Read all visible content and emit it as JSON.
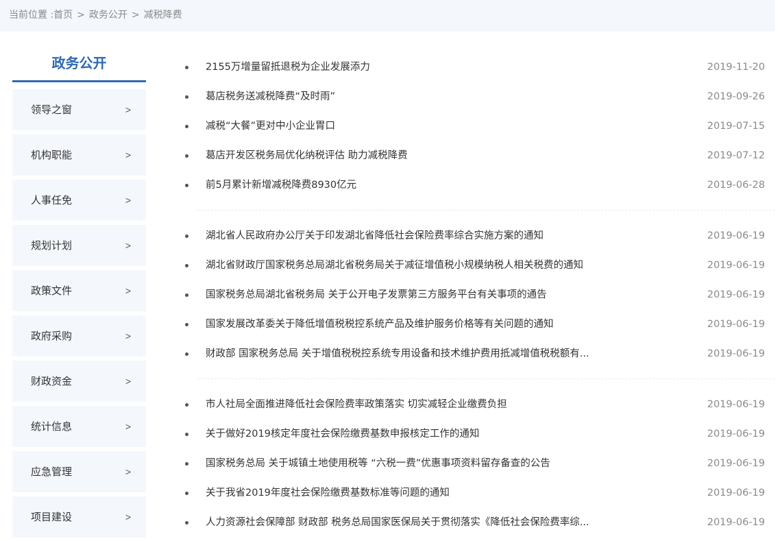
{
  "breadcrumb": {
    "prefix": "当前位置 :",
    "items": [
      "首页",
      "政务公开",
      "减税降费"
    ],
    "separator": ">"
  },
  "sidebar": {
    "title": "政务公开",
    "items": [
      {
        "label": "领导之窗"
      },
      {
        "label": "机构职能"
      },
      {
        "label": "人事任免"
      },
      {
        "label": "规划计划"
      },
      {
        "label": "政策文件"
      },
      {
        "label": "政府采购"
      },
      {
        "label": "财政资金"
      },
      {
        "label": "统计信息"
      },
      {
        "label": "应急管理"
      },
      {
        "label": "项目建设"
      }
    ],
    "chevron": ">"
  },
  "news_groups": [
    [
      {
        "title": "2155万增量留抵退税为企业发展添力",
        "date": "2019-11-20"
      },
      {
        "title": "葛店税务送减税降费“及时雨”",
        "date": "2019-09-26"
      },
      {
        "title": "减税“大餐”更对中小企业胃口",
        "date": "2019-07-15"
      },
      {
        "title": "葛店开发区税务局优化纳税评估 助力减税降费",
        "date": "2019-07-12"
      },
      {
        "title": "前5月累计新增减税降费8930亿元",
        "date": "2019-06-28"
      }
    ],
    [
      {
        "title": "湖北省人民政府办公厅关于印发湖北省降低社会保险费率综合实施方案的通知",
        "date": "2019-06-19"
      },
      {
        "title": "湖北省财政厅国家税务总局湖北省税务局关于减征增值税小规模纳税人相关税费的通知",
        "date": "2019-06-19"
      },
      {
        "title": "国家税务总局湖北省税务局 关于公开电子发票第三方服务平台有关事项的通告",
        "date": "2019-06-19"
      },
      {
        "title": "国家发展改革委关于降低增值税税控系统产品及维护服务价格等有关问题的通知",
        "date": "2019-06-19"
      },
      {
        "title": "财政部 国家税务总局 关于增值税税控系统专用设备和技术维护费用抵减增值税税额有...",
        "date": "2019-06-19"
      }
    ],
    [
      {
        "title": "市人社局全面推进降低社会保险费率政策落实 切实减轻企业缴费负担",
        "date": "2019-06-19"
      },
      {
        "title": "关于做好2019核定年度社会保险缴费基数申报核定工作的通知",
        "date": "2019-06-19"
      },
      {
        "title": "国家税务总局 关于城镇土地使用税等 “六税一费”优惠事项资料留存备查的公告",
        "date": "2019-06-19"
      },
      {
        "title": "关于我省2019年度社会保险缴费基数标准等问题的通知",
        "date": "2019-06-19"
      },
      {
        "title": "人力资源社会保障部 财政部 税务总局国家医保局关于贯彻落实《降低社会保险费率综...",
        "date": "2019-06-19"
      }
    ]
  ],
  "colors": {
    "accent": "#2d69b5",
    "panel_bg": "#f4f7fc",
    "muted_text": "#8a8a8a"
  }
}
